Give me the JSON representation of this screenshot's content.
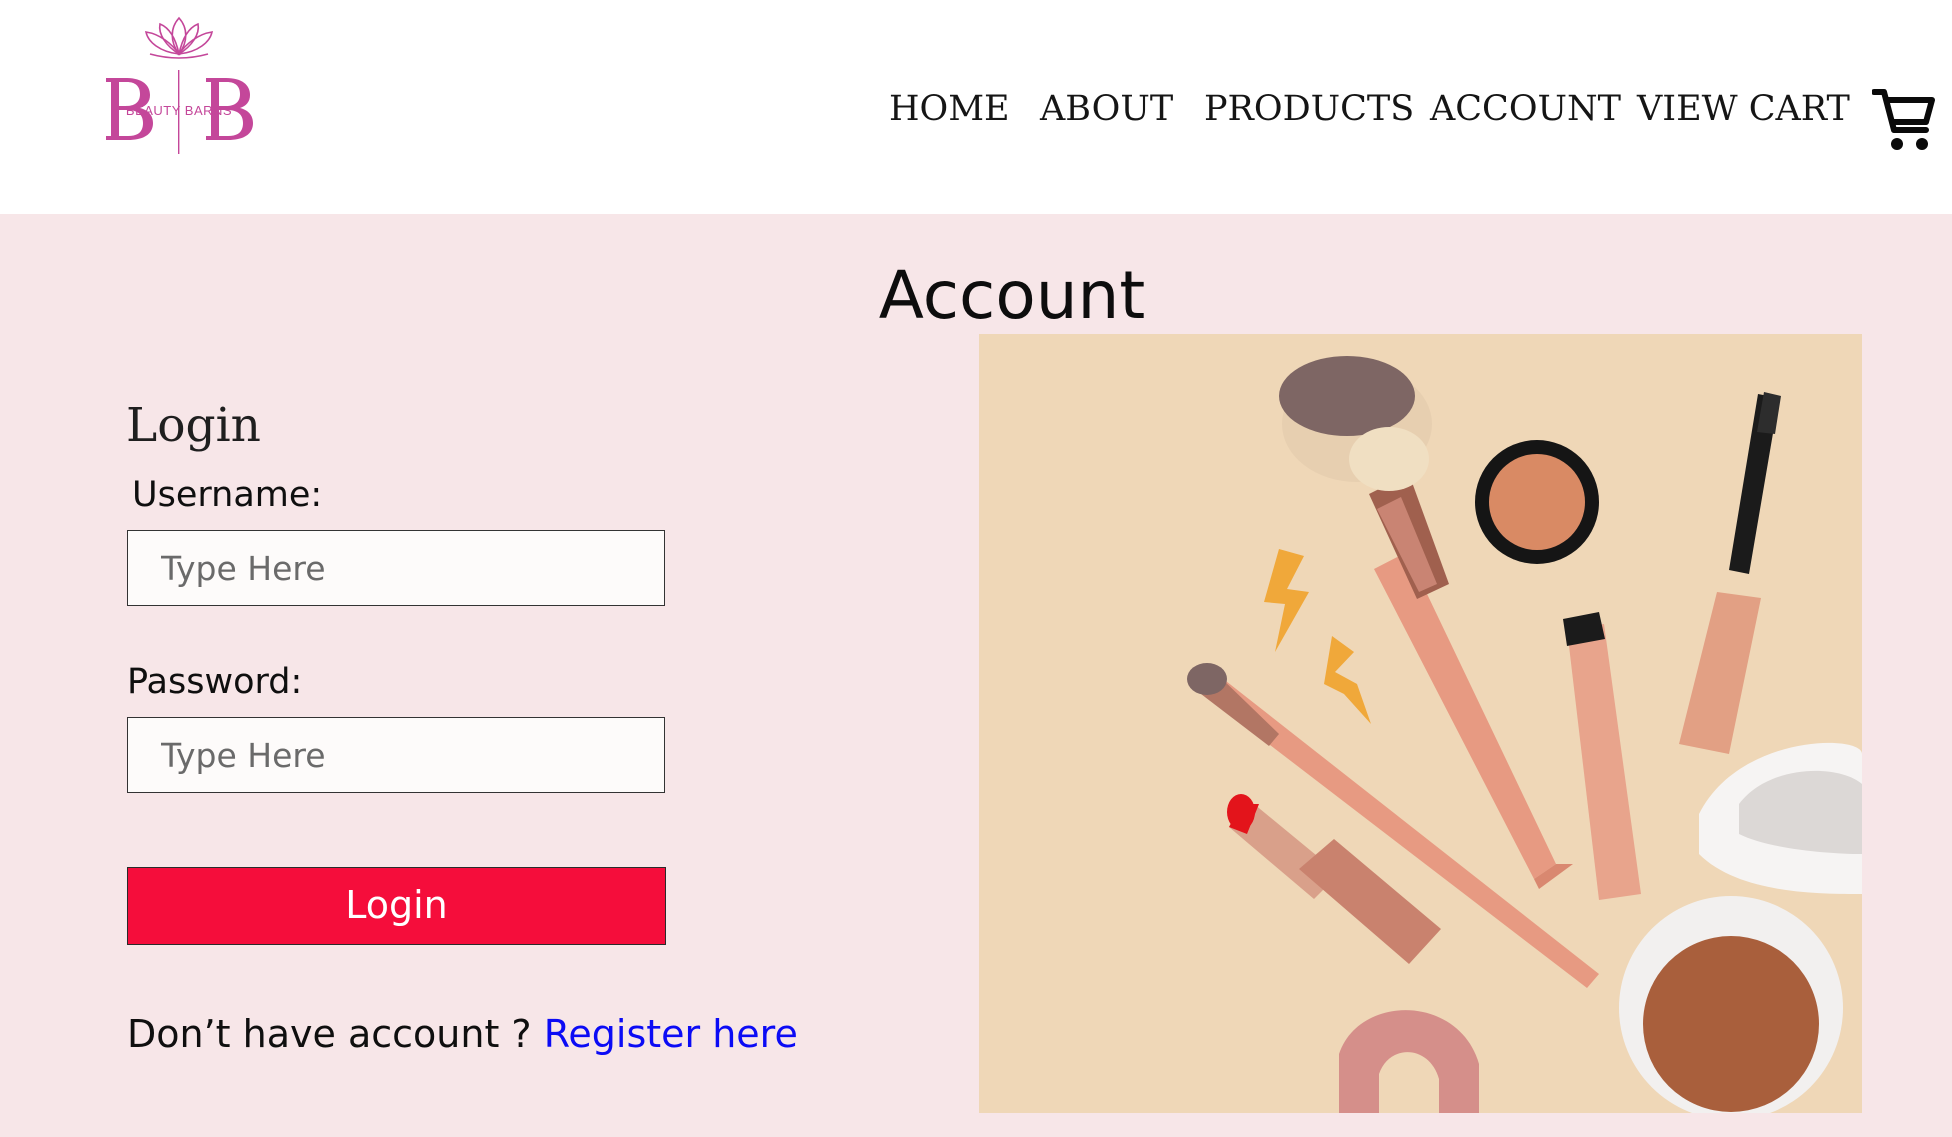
{
  "brand": {
    "logo_letters": "B B",
    "logo_tagline": "BEAUTY BARNS",
    "logo_color": "#c4479a"
  },
  "nav": {
    "items": [
      {
        "label": "HOME"
      },
      {
        "label": "ABOUT"
      },
      {
        "label": "PRODUCTS"
      },
      {
        "label": "ACCOUNT"
      },
      {
        "label": "VIEW CART"
      }
    ],
    "cart_icon": "shopping-cart-icon"
  },
  "page": {
    "title": "Account",
    "background": "#f7e6e8"
  },
  "login": {
    "heading": "Login",
    "username_label": "Username:",
    "username_placeholder": "Type Here",
    "username_value": "",
    "password_label": "Password:",
    "password_placeholder": "Type Here",
    "password_value": "",
    "button_label": "Login",
    "button_color": "#f50d3b",
    "register_prompt": "Don’t have account ? ",
    "register_link": "Register here",
    "link_color": "#0b0bf5"
  },
  "hero": {
    "icon": "makeup-products-image",
    "background": "#efd7b7"
  }
}
